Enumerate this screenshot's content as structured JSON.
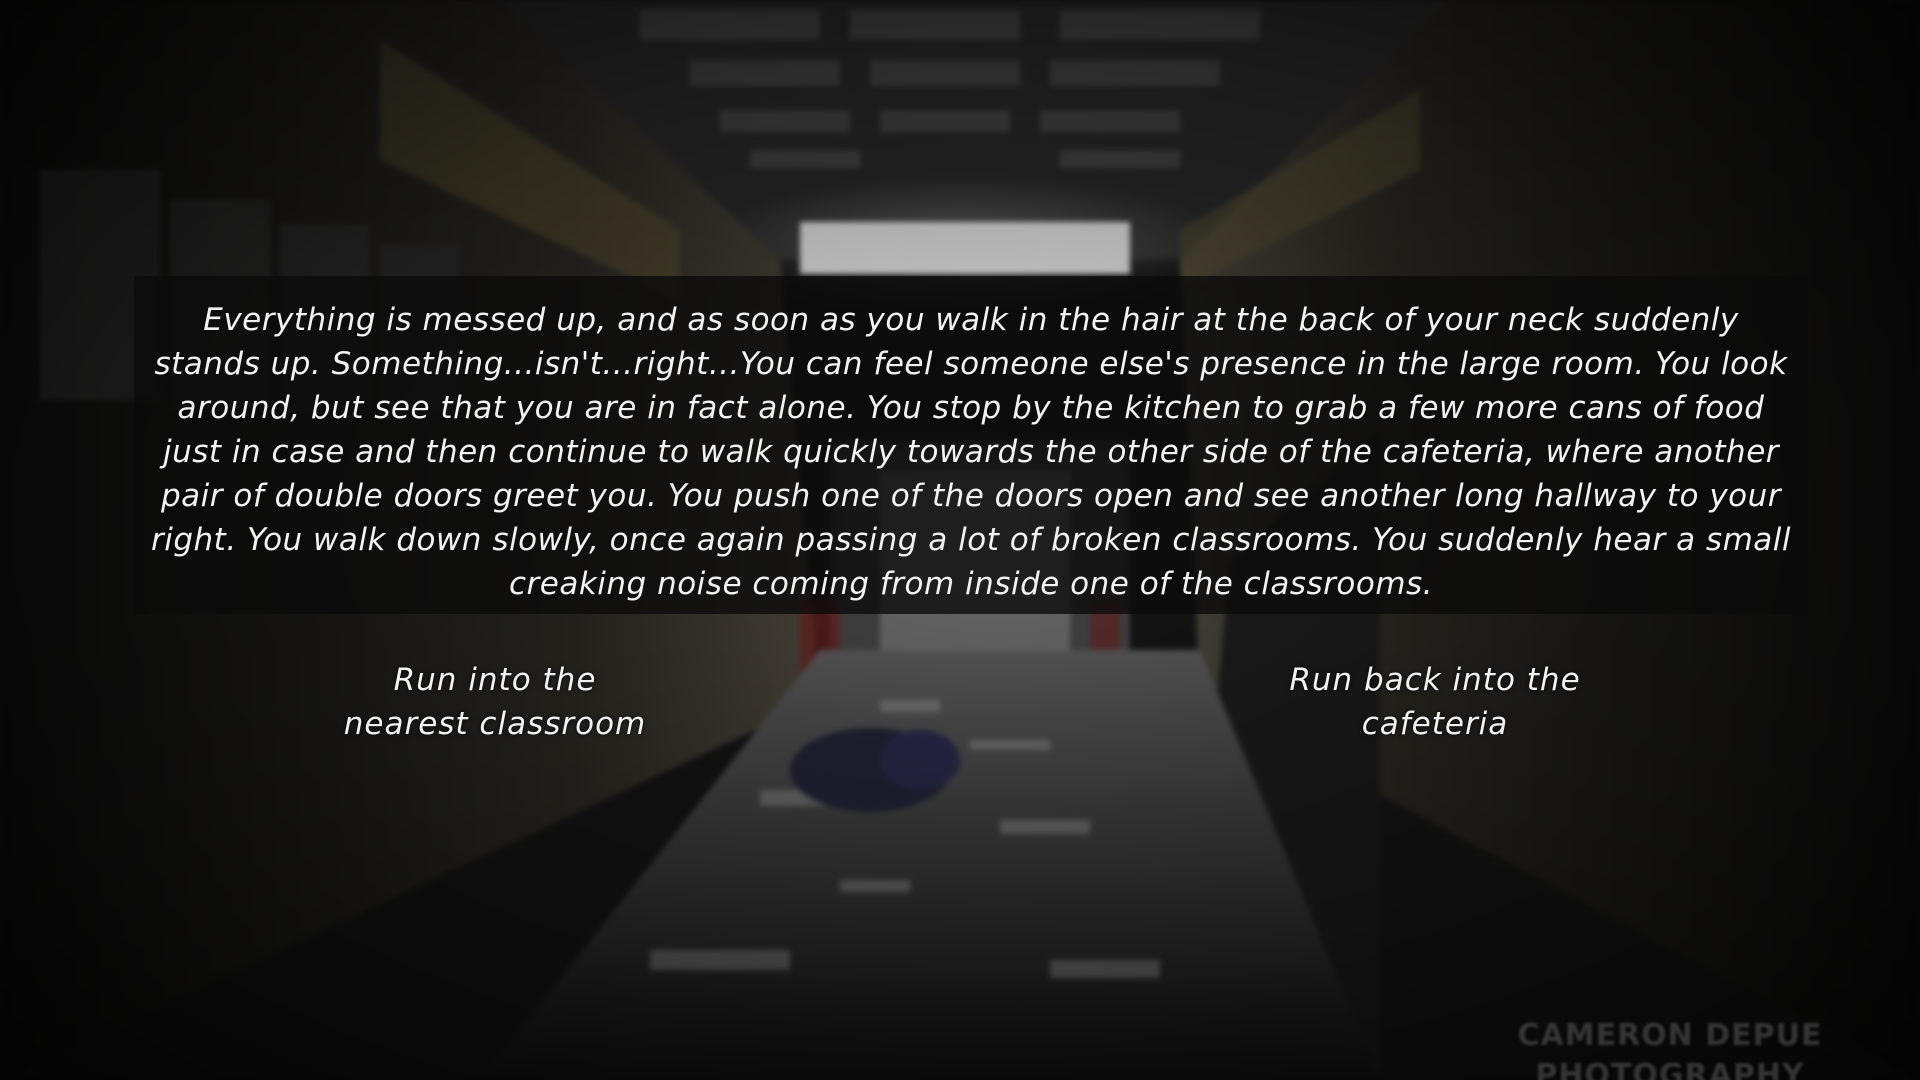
{
  "story": {
    "text": "Everything is messed up, and as soon as you walk in the hair at the back of your neck suddenly stands up. Something...isn't...right...You can feel someone else's presence in the large room. You look around, but see that you are in fact alone. You stop by the kitchen to grab a few more cans of food just in case and then continue to walk quickly towards the other side of the cafeteria, where another pair of double doors greet you. You push one of the doors open and see another long hallway to your right. You walk down slowly, once again passing a lot of broken classrooms. You suddenly hear a small creaking noise coming from inside one of the classrooms."
  },
  "choices": {
    "left": {
      "line1": "Run into the",
      "line2": "nearest classroom"
    },
    "right": {
      "line1": "Run back into the",
      "line2": "cafeteria"
    }
  },
  "watermark": {
    "line1": "CAMERON DEPUE",
    "line2": "PHOTOGRAPHY"
  },
  "colors": {
    "text": "#f2f2f2",
    "panel": "#0a0a0a",
    "background": "#141414"
  }
}
